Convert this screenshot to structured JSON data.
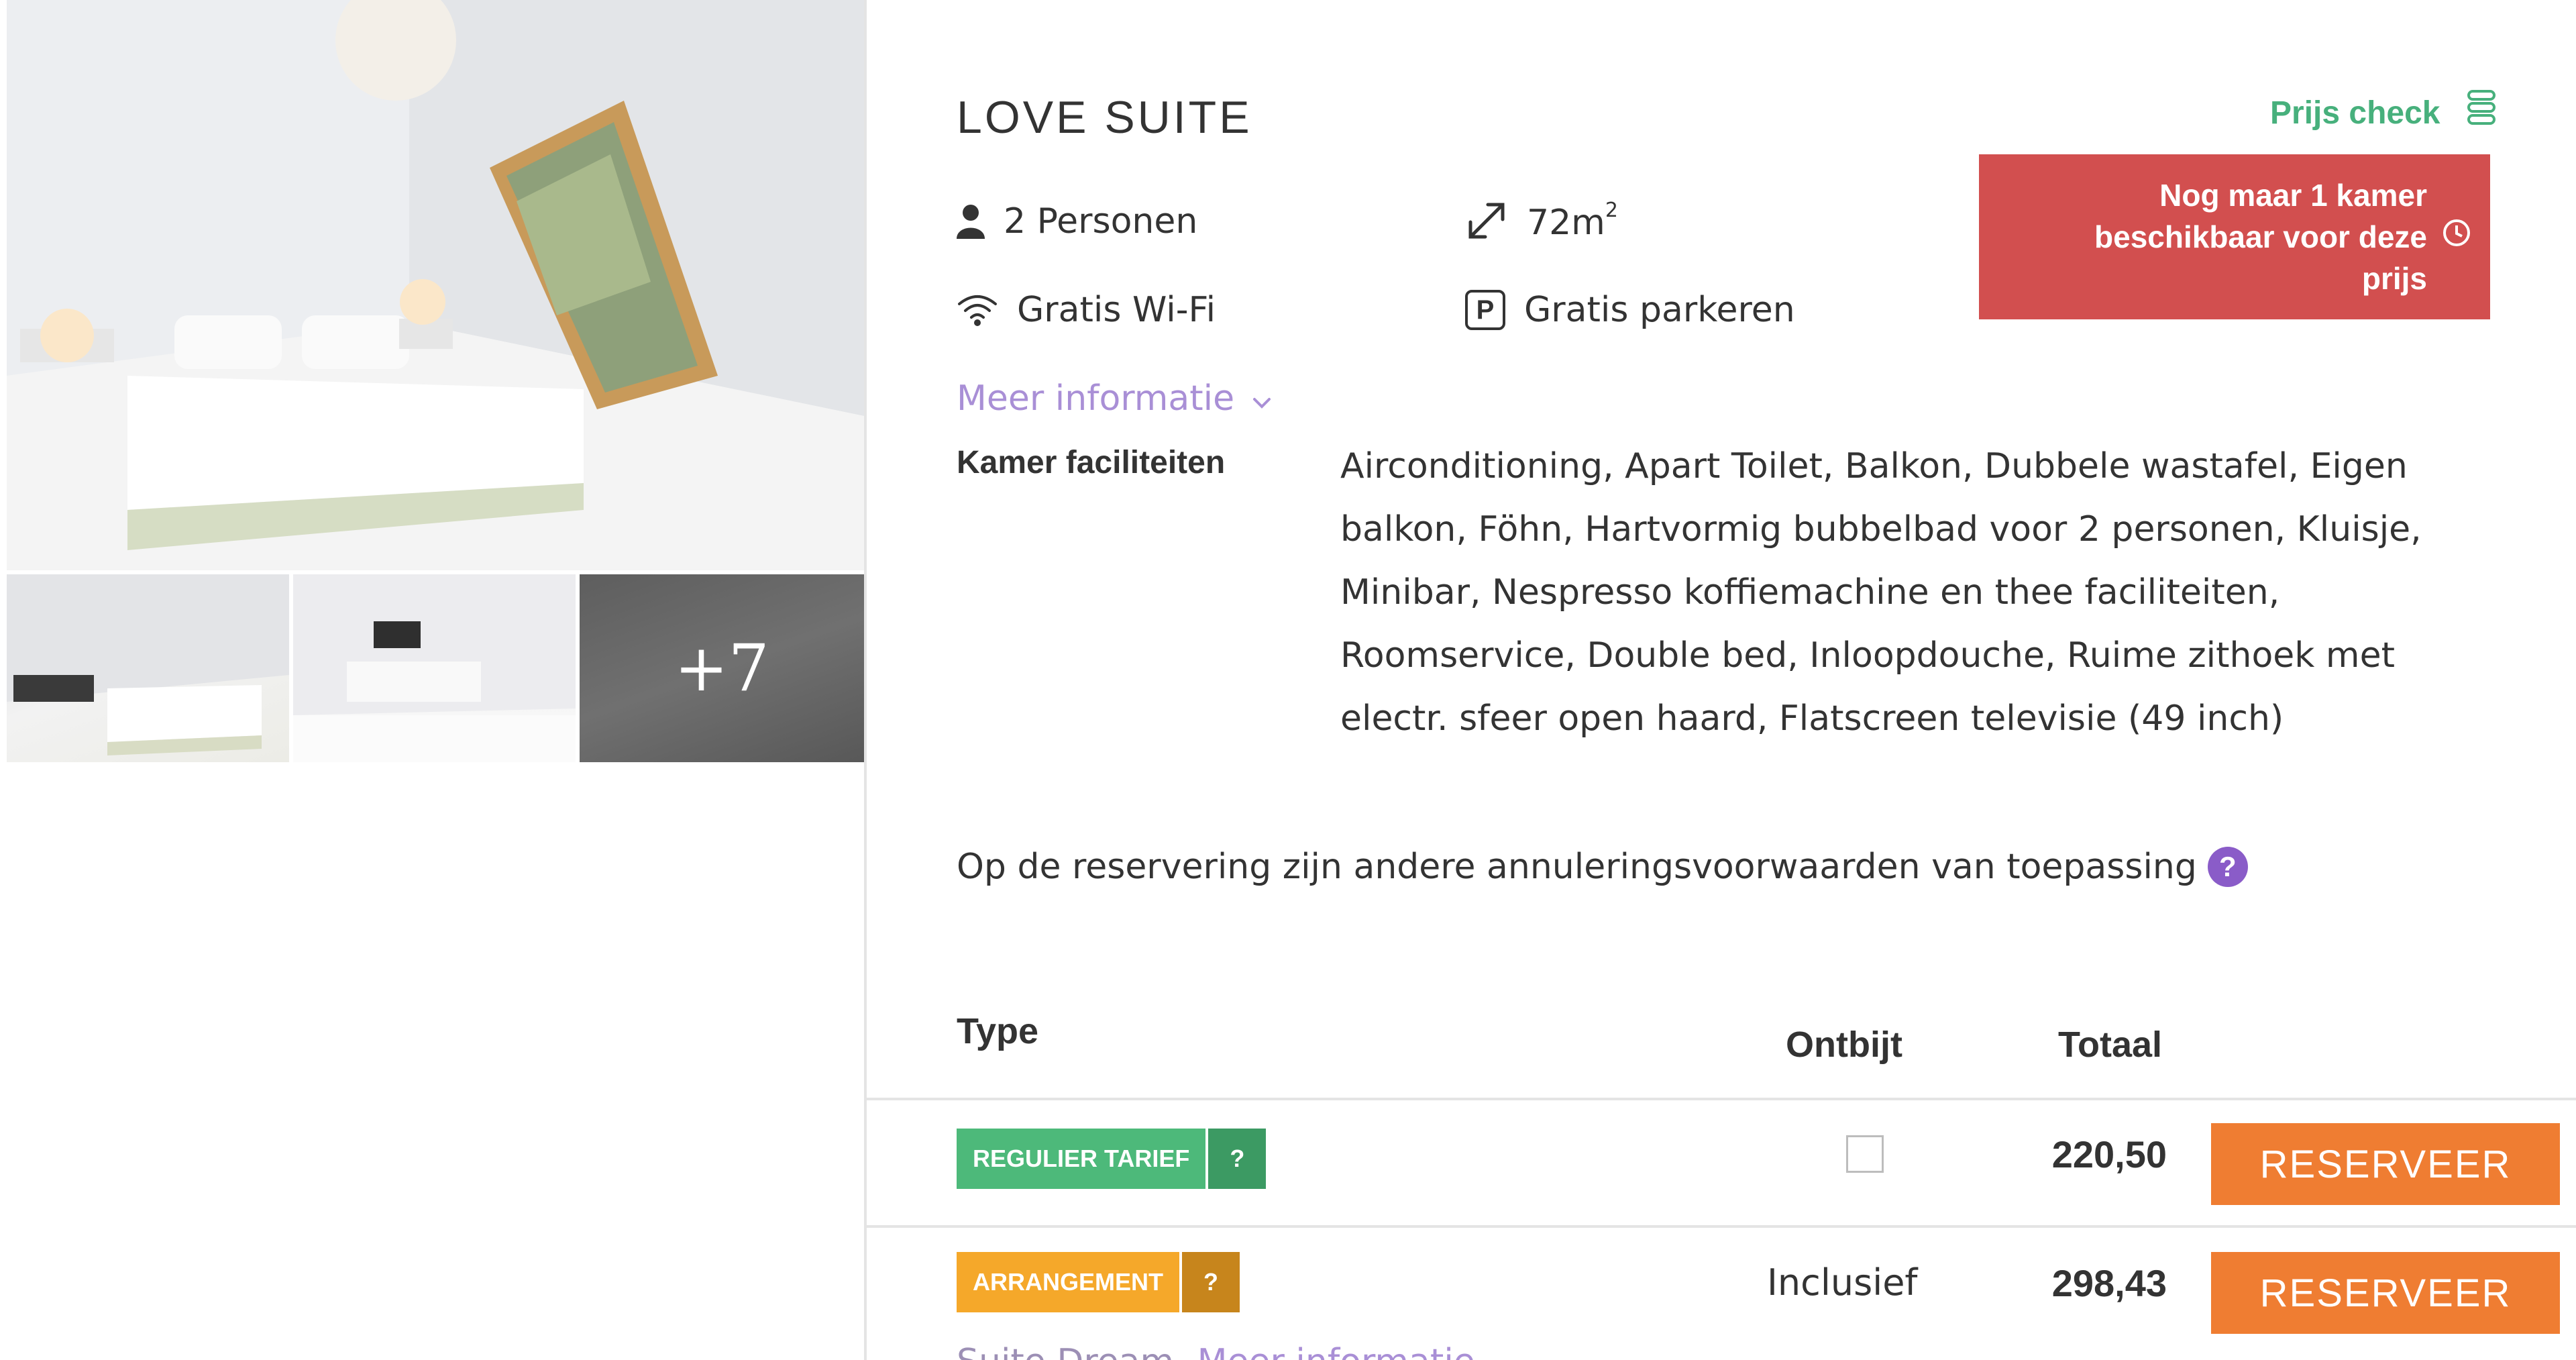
{
  "gallery": {
    "more_photos_label": "+7"
  },
  "room": {
    "title": "LOVE SUITE",
    "persons": "2 Personen",
    "size": "72m",
    "size_sup": "2",
    "wifi": "Gratis Wi-Fi",
    "parking": "Gratis parkeren",
    "parking_icon_letter": "P",
    "more_info": "Meer informatie",
    "facilities_label": "Kamer faciliteiten",
    "facilities_text": "Airconditioning, Apart Toilet, Balkon, Dubbele wastafel, Eigen balkon, Föhn, Hartvormig bubbelbad voor 2 personen, Kluisje, Minibar, Nespresso koffiemachine en thee faciliteiten, Roomservice, Double bed, Inloopdouche, Ruime zithoek met electr. sfeer open haard, Flatscreen televisie (49 inch)"
  },
  "price_check": {
    "label": "Prijs check"
  },
  "availability_alert": {
    "text": "Nog maar 1 kamer beschikbaar voor deze prijs"
  },
  "cancellation_note": {
    "text": "Op de reservering zijn andere annuleringsvoorwaarden van toepassing",
    "help": "?"
  },
  "rates": {
    "headers": {
      "type": "Type",
      "breakfast": "Ontbijt",
      "total": "Totaal"
    },
    "rows": [
      {
        "label": "REGULIER TARIEF",
        "help": "?",
        "breakfast_checked": false,
        "total": "220,50",
        "button": "RESERVEER"
      },
      {
        "label": "ARRANGEMENT",
        "help": "?",
        "breakfast": "Inclusief",
        "total": "298,43",
        "button": "RESERVEER"
      }
    ],
    "cut_off_text": "Suite Dream",
    "cut_off_link": "Meer informatie"
  },
  "colors": {
    "alert_red": "#d24f4f",
    "accent_green": "#47b07c",
    "link_purple": "#a98fd6",
    "help_purple": "#8a5cc8",
    "regular_badge": "#4db97a",
    "arrangement_badge": "#f5a82a",
    "reserve_orange": "#ef7d32"
  },
  "icons": {
    "persons": "person-icon",
    "size": "expand-arrows-icon",
    "wifi": "wifi-icon",
    "parking": "parking-icon",
    "more_info": "chevron-down-icon",
    "price_check": "price-tag-icon",
    "alert": "clock-icon",
    "help": "help-icon"
  }
}
